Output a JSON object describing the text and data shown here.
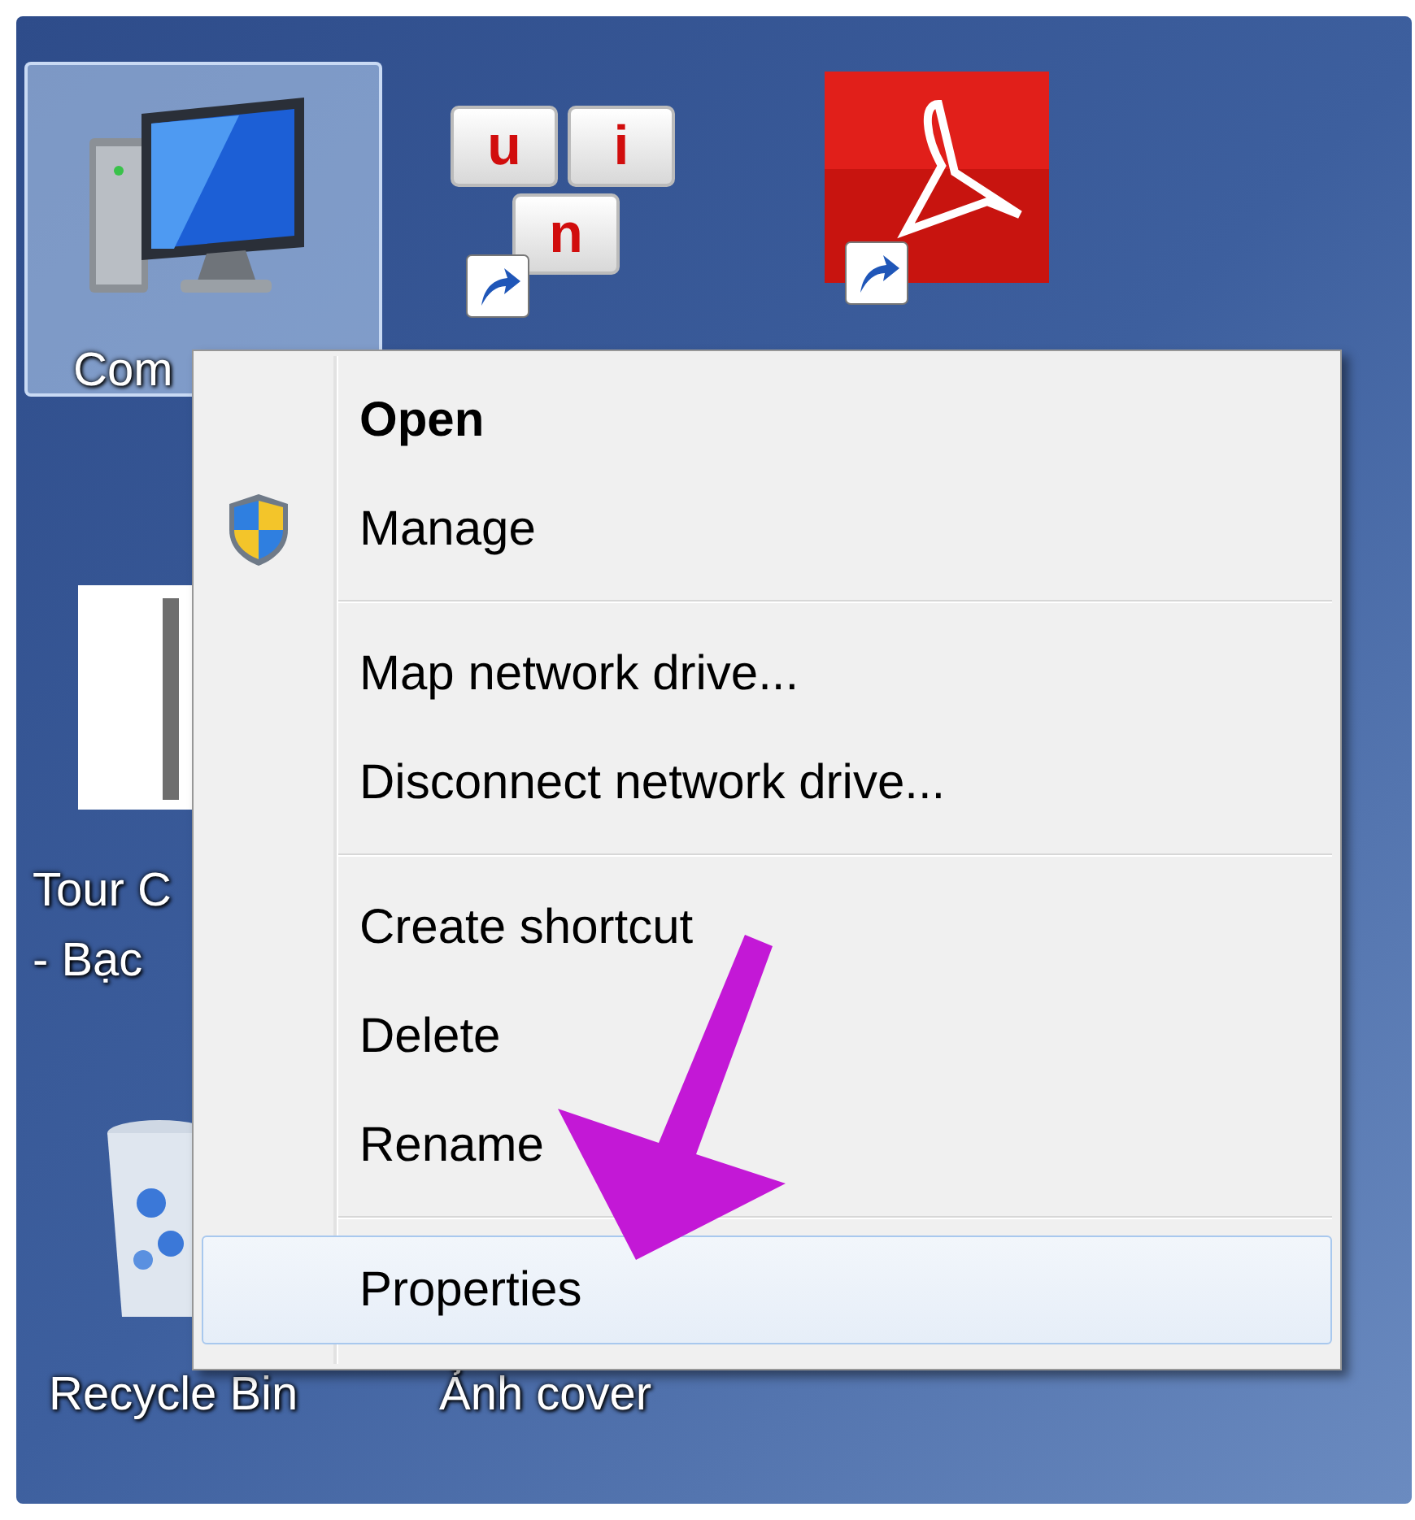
{
  "desktop_icons": [
    {
      "kind": "computer",
      "label": "Com",
      "selected": true,
      "shortcut": false
    },
    {
      "kind": "unikey",
      "keys": [
        "u",
        "i",
        "n"
      ],
      "selected": false,
      "shortcut": true
    },
    {
      "kind": "pdf",
      "selected": false,
      "shortcut": true
    },
    {
      "kind": "document",
      "label": "Tour C",
      "label_line2": "- Bạc",
      "selected": false,
      "shortcut": false
    },
    {
      "kind": "recycle-bin",
      "label": "Recycle Bin",
      "selected": false,
      "shortcut": false
    },
    {
      "kind": "file",
      "label": "Ảnh cover",
      "selected": false,
      "shortcut": false
    }
  ],
  "context_menu": {
    "items": [
      {
        "kind": "item",
        "label": "Open",
        "default": true,
        "selected": false
      },
      {
        "kind": "admin-item",
        "label": "Manage",
        "default": false,
        "selected": false
      },
      {
        "kind": "separator"
      },
      {
        "kind": "item",
        "label": "Map network drive...",
        "default": false,
        "selected": false
      },
      {
        "kind": "item",
        "label": "Disconnect network drive...",
        "default": false,
        "selected": false
      },
      {
        "kind": "separator"
      },
      {
        "kind": "item",
        "label": "Create shortcut",
        "default": false,
        "selected": false
      },
      {
        "kind": "item",
        "label": "Delete",
        "default": false,
        "selected": false
      },
      {
        "kind": "item",
        "label": "Rename",
        "default": false,
        "selected": false
      },
      {
        "kind": "separator"
      },
      {
        "kind": "item",
        "label": "Properties",
        "default": false,
        "selected": true
      }
    ]
  },
  "annotation": {
    "kind": "arrow"
  }
}
